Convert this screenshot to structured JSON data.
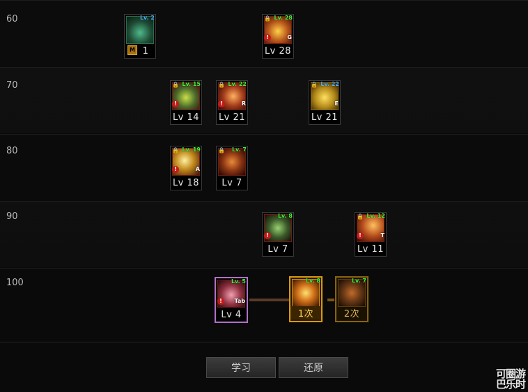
{
  "rows": [
    {
      "level": "60"
    },
    {
      "level": "70"
    },
    {
      "level": "80"
    },
    {
      "level": "90"
    },
    {
      "level": "100"
    }
  ],
  "skills": {
    "s60a": {
      "tag": "Lv. 2",
      "value": "1",
      "badge": "M",
      "icon": "green-orb-icon",
      "color": "#1e4a34"
    },
    "s60b": {
      "tag": "Lv. 28",
      "value": "Lv 28",
      "key": "G",
      "icon": "golden-flame-icon",
      "color": "#b8561a"
    },
    "s70a": {
      "tag": "Lv. 15",
      "value": "Lv 14",
      "icon": "green-aura-icon",
      "color": "#4a6a2a"
    },
    "s70b": {
      "tag": "Lv. 22",
      "value": "Lv 21",
      "key": "R",
      "icon": "red-slash-icon",
      "color": "#a33b1a"
    },
    "s70c": {
      "tag": "Lv. 22",
      "value": "Lv 21",
      "key": "E",
      "icon": "gold-beast-icon",
      "color": "#b48a1a"
    },
    "s80a": {
      "tag": "Lv. 19",
      "value": "Lv 18",
      "key": "A",
      "icon": "yellow-burst-icon",
      "color": "#c28a1e"
    },
    "s80b": {
      "tag": "Lv. 7",
      "value": "Lv 7",
      "icon": "fire-demon-icon",
      "color": "#8a3412"
    },
    "s90a": {
      "tag": "Lv. 8",
      "value": "Lv 7",
      "icon": "green-spirit-icon",
      "color": "#3a5a2a"
    },
    "s90b": {
      "tag": "Lv. 12",
      "value": "Lv 11",
      "key": "T",
      "icon": "red-strike-icon",
      "color": "#b2481a"
    },
    "s100a": {
      "tag": "Lv. 5",
      "value": "Lv 4",
      "key": "Tab",
      "icon": "pink-blade-icon",
      "color": "#8e3040"
    },
    "s100b": {
      "tag": "Lv. 8",
      "value": "1次",
      "icon": "sun-burst-icon",
      "color": "#d07018"
    },
    "s100c": {
      "tag": "Lv. 7",
      "value": "2次",
      "icon": "dark-fire-icon",
      "color": "#6a3a16"
    }
  },
  "buttons": {
    "learn": "学习",
    "reset": "还原"
  },
  "watermark": {
    "line1": "可圈游",
    "line2": "巴乐时"
  }
}
